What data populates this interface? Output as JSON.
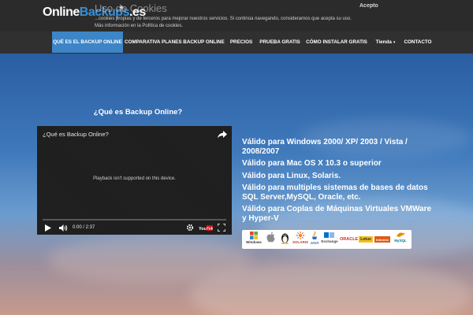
{
  "header": {
    "logo": {
      "part1": "Online",
      "part2": "Backups",
      "part3": ".es"
    },
    "cookie": {
      "title": "Uso de Cookies",
      "text": "...cookies propias y de terceros para mejorar nuestros servicios. Si continúa navegando, consideramos que acepta su uso. Más información en la Política de cookies.",
      "accept_label": "Acepto"
    }
  },
  "nav": {
    "items": [
      {
        "label": "QUÉ ES EL BACKUP ONLINE",
        "active": true
      },
      {
        "label": "COMPARATIVA PLANES BACKUP ONLINE",
        "active": false
      },
      {
        "label": "PRECIOS",
        "active": false
      },
      {
        "label": "PRUEBA GRATIS",
        "active": false
      },
      {
        "label": "CÓMO INSTALAR GRATIS",
        "active": false
      },
      {
        "label": "Tienda",
        "active": false,
        "has_dropdown": true
      },
      {
        "label": "CONTACTO",
        "active": false
      }
    ]
  },
  "main": {
    "section_title": "¿Qué es Backup Online?",
    "video": {
      "title": "¿Qué es Backup Online?",
      "message": "Playback isn't supported on this device.",
      "time": "0:00 / 2:37",
      "progress": 0,
      "brand": "YouTube"
    },
    "features": [
      "Válido para Windows 2000/ XP/ 2003 / Vista / 2008/2007",
      "Válido para Mac OS X 10.3 o superior",
      "Válido para  Linux, Solaris.",
      "Válido para multiples sistemas de bases de datos SQL Server,MySQL, Oracle, etc.",
      "Válido para Coplas de Máquinas Virtuales VMWare y Hyper-V"
    ],
    "platform_logos": [
      {
        "label": "Windows",
        "icon": "windows-icon"
      },
      {
        "label": "",
        "icon": "apple-icon"
      },
      {
        "label": "",
        "icon": "linux-tux-icon"
      },
      {
        "label": "SOLARIS",
        "icon": "solaris-icon"
      },
      {
        "label": "JAVA",
        "icon": "java-icon"
      },
      {
        "label": "Exchange",
        "icon": "exchange-icon"
      },
      {
        "label": "ORACLE",
        "icon": "oracle-icon"
      },
      {
        "label": "Lotus",
        "icon": "lotus-icon"
      },
      {
        "label": "Informix",
        "icon": "informix-icon"
      },
      {
        "label": "MySQL",
        "icon": "mysql-icon"
      }
    ]
  },
  "colors": {
    "nav_active": "#3d85c6",
    "nav_bg": "#303030",
    "topbar_bg": "#2b2b2b",
    "logo_accent": "#3a8fd8",
    "progress": "#cc181e"
  }
}
